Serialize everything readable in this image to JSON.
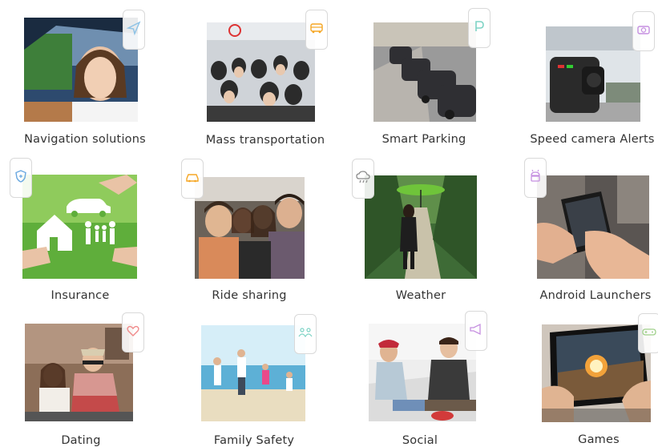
{
  "tiles": [
    {
      "label": "Navigation solutions",
      "icon": "navigation-arrow-icon",
      "accent": "#8fc3e6"
    },
    {
      "label": "Mass transportation",
      "icon": "bus-icon",
      "accent": "#f5a623"
    },
    {
      "label": "Smart Parking",
      "icon": "parking-p-icon",
      "accent": "#7ed3c5"
    },
    {
      "label": "Speed camera Alerts",
      "icon": "camera-icon",
      "accent": "#c58fe0"
    },
    {
      "label": "Insurance",
      "icon": "shield-icon",
      "accent": "#6aa8e0"
    },
    {
      "label": "Ride sharing",
      "icon": "car-icon",
      "accent": "#f5a623"
    },
    {
      "label": "Weather",
      "icon": "cloud-rain-icon",
      "accent": "#8a8a8a"
    },
    {
      "label": "Android Launchers",
      "icon": "android-icon",
      "accent": "#c58fe0"
    },
    {
      "label": "Dating",
      "icon": "heart-icon",
      "accent": "#f08a8a"
    },
    {
      "label": "Family Safety",
      "icon": "family-icon",
      "accent": "#7ed3c5"
    },
    {
      "label": "Social",
      "icon": "megaphone-icon",
      "accent": "#c58fe0"
    },
    {
      "label": "Games",
      "icon": "gamepad-icon",
      "accent": "#9fd08a"
    }
  ]
}
